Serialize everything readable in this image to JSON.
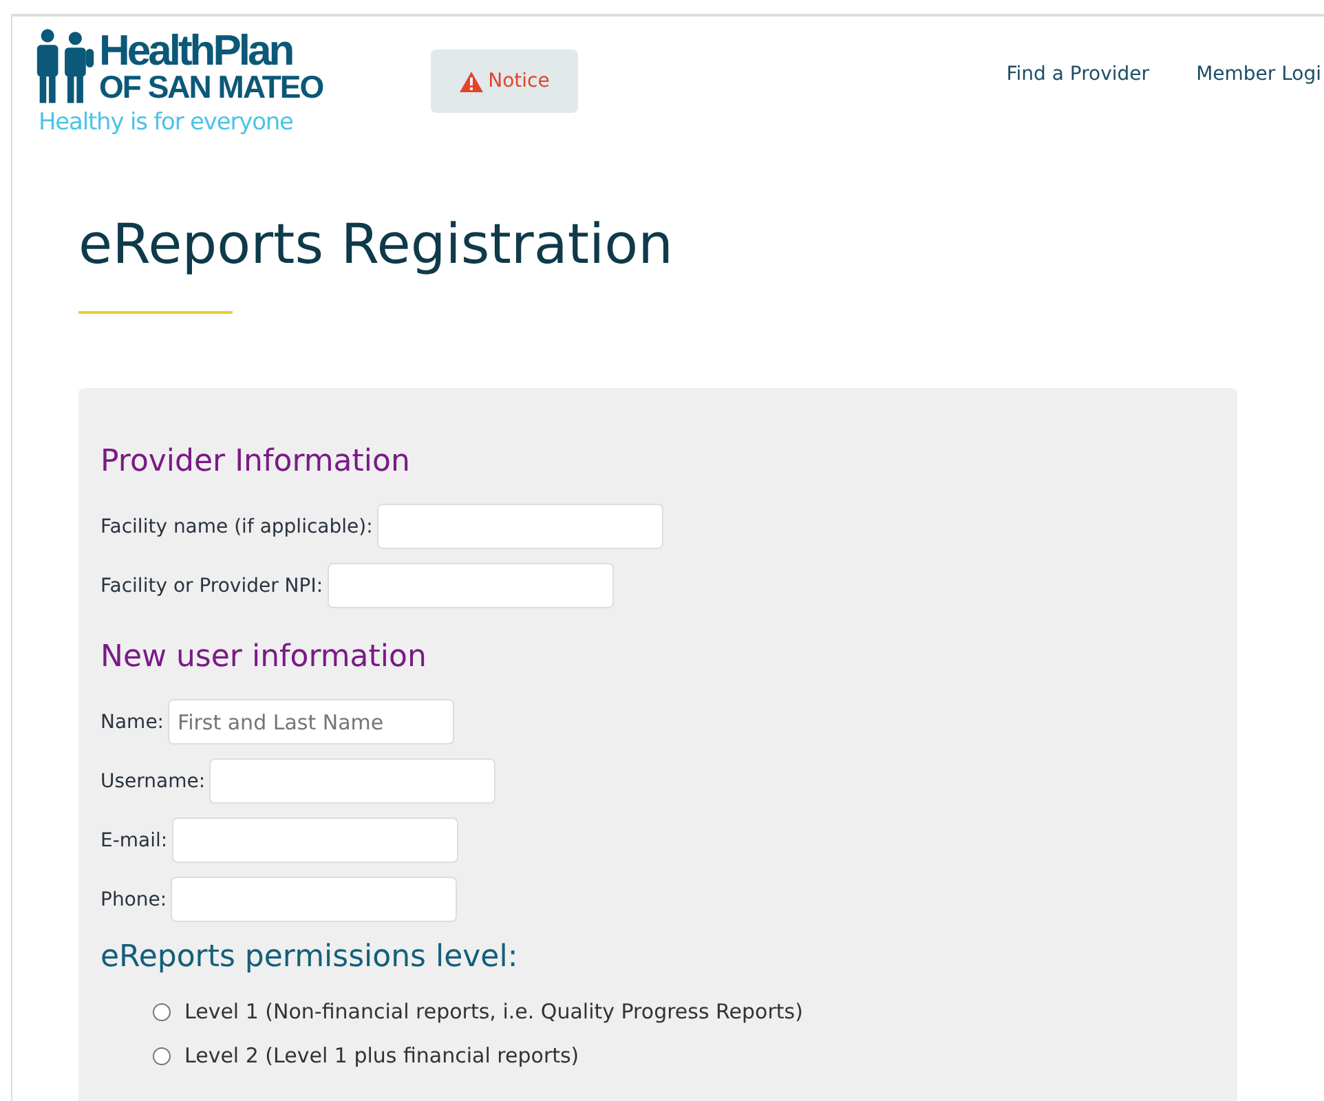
{
  "logo": {
    "line_1": "HealthPlan",
    "line_2": "OF SAN MATEO",
    "tagline": "Healthy is for everyone"
  },
  "notice": {
    "label": "Notice"
  },
  "nav": [
    "Find a Provider",
    "Member Logi"
  ],
  "title": "eReports Registration",
  "sections": [
    {
      "heading": "Provider Information",
      "kind": "fields",
      "fields": [
        {
          "label": "Facility name (if applicable):"
        },
        {
          "label": "Facility or Provider NPI:"
        }
      ]
    },
    {
      "heading": "New user information",
      "kind": "fields",
      "fields": [
        {
          "label": "Name:",
          "placeholder": "First and Last Name"
        },
        {
          "label": "Username:"
        },
        {
          "label": "E-mail:"
        },
        {
          "label": "Phone:"
        }
      ]
    },
    {
      "heading": "eReports permissions level:",
      "kind": "radios",
      "options": [
        {
          "label": "Level 1 (Non-financial reports, i.e. Quality Progress Reports)",
          "selected": false
        },
        {
          "label": "Level 2 (Level 1 plus financial reports)",
          "selected": false
        }
      ]
    }
  ]
}
